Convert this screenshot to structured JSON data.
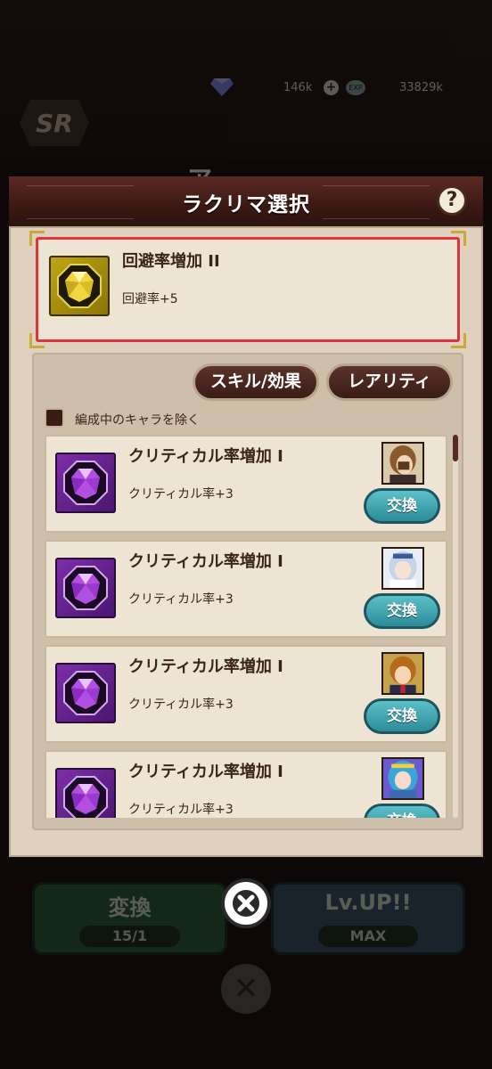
{
  "background": {
    "gem_count": "146k",
    "exp_count": "33829k",
    "exp_badge": "EXP",
    "rarity_badge": "SR",
    "character_name": "ア",
    "convert_button": {
      "label": "変換",
      "sub": "15/1"
    },
    "levelup_button": {
      "label": "Lv.UP!!",
      "sub": "MAX"
    }
  },
  "modal": {
    "title": "ラクリマ選択",
    "help_label": "?",
    "selected": {
      "name": "回避率増加 II",
      "description": "回避率+5",
      "gem_color": "gold"
    },
    "filters": {
      "skill_effect_label": "スキル/効果",
      "rarity_label": "レアリティ"
    },
    "exclude_checkbox_label": "編成中のキャラを除く",
    "items": [
      {
        "name": "クリティカル率増加 I",
        "description": "クリティカル率+3",
        "button": "交換",
        "gem_color": "purple",
        "portrait": "brown-hair-character"
      },
      {
        "name": "クリティカル率増加 I",
        "description": "クリティカル率+3",
        "button": "交換",
        "gem_color": "purple",
        "portrait": "silver-hair-character"
      },
      {
        "name": "クリティカル率増加 I",
        "description": "クリティカル率+3",
        "button": "交換",
        "gem_color": "purple",
        "portrait": "orange-hair-character"
      },
      {
        "name": "クリティカル率増加 I",
        "description": "クリティカル率+3",
        "button": "交換",
        "gem_color": "purple",
        "portrait": "blue-hair-character"
      }
    ]
  },
  "colors": {
    "accent_red": "#e0333a",
    "header_brown": "#3b1914",
    "exchange_teal": "#2b8c98"
  }
}
